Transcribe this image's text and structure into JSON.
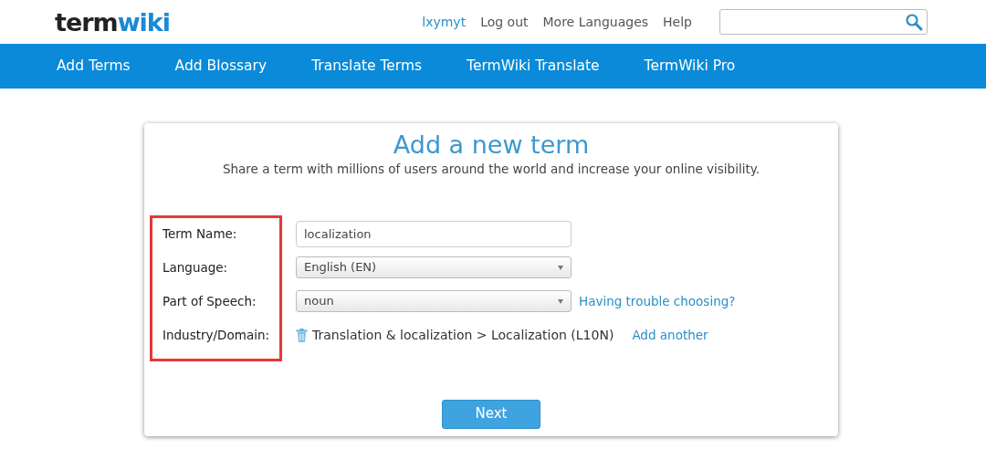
{
  "header": {
    "logo": {
      "dark": "term",
      "accent": "wiki"
    },
    "user_link": "lxymyt",
    "links": [
      "Log out",
      "More Languages",
      "Help"
    ]
  },
  "nav": [
    "Add Terms",
    "Add Blossary",
    "Translate Terms",
    "TermWiki Translate",
    "TermWiki Pro"
  ],
  "form": {
    "title": "Add a new term",
    "subtitle": "Share a term with millions of users around the world and increase your online visibility.",
    "labels_highlighted": true,
    "rows": [
      {
        "kind": "text",
        "label": "Term Name:",
        "value": "localization"
      },
      {
        "kind": "select",
        "label": "Language:",
        "value": "English (EN)"
      },
      {
        "kind": "select",
        "label": "Part of Speech:",
        "value": "noun",
        "link": "Having trouble choosing?"
      },
      {
        "kind": "domain",
        "label": "Industry/Domain:",
        "value": "Translation & localization > Localization (L10N)",
        "link": "Add another"
      }
    ],
    "next_button": "Next"
  }
}
